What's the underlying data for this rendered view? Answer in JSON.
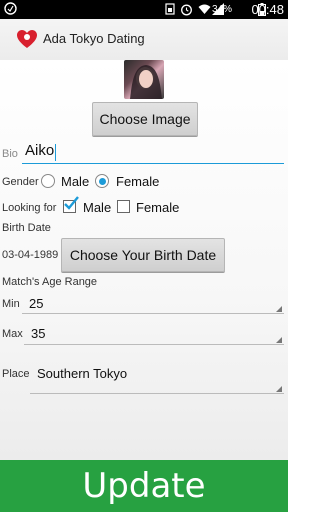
{
  "status_bar": {
    "battery_percent": "34%",
    "time": "00:48"
  },
  "app": {
    "title": "Ada Tokyo Dating",
    "logo": "heart-logo"
  },
  "image": {
    "choose_label": "Choose Image"
  },
  "bio": {
    "label": "Bio",
    "value": "Aiko"
  },
  "gender": {
    "label": "Gender",
    "options": [
      "Male",
      "Female"
    ],
    "selected": "Female"
  },
  "looking_for": {
    "label": "Looking for",
    "options": [
      "Male",
      "Female"
    ],
    "checked": [
      "Male"
    ]
  },
  "birth": {
    "label": "Birth Date",
    "value": "03-04-1989",
    "button_label": "Choose Your Birth Date"
  },
  "age_range": {
    "label": "Match's Age Range",
    "min_label": "Min",
    "min_value": "25",
    "max_label": "Max",
    "max_value": "35"
  },
  "place": {
    "label": "Place",
    "value": "Southern Tokyo"
  },
  "update": {
    "label": "Update"
  },
  "colors": {
    "accent": "#1c9bd8",
    "update_bg": "#27a141"
  }
}
